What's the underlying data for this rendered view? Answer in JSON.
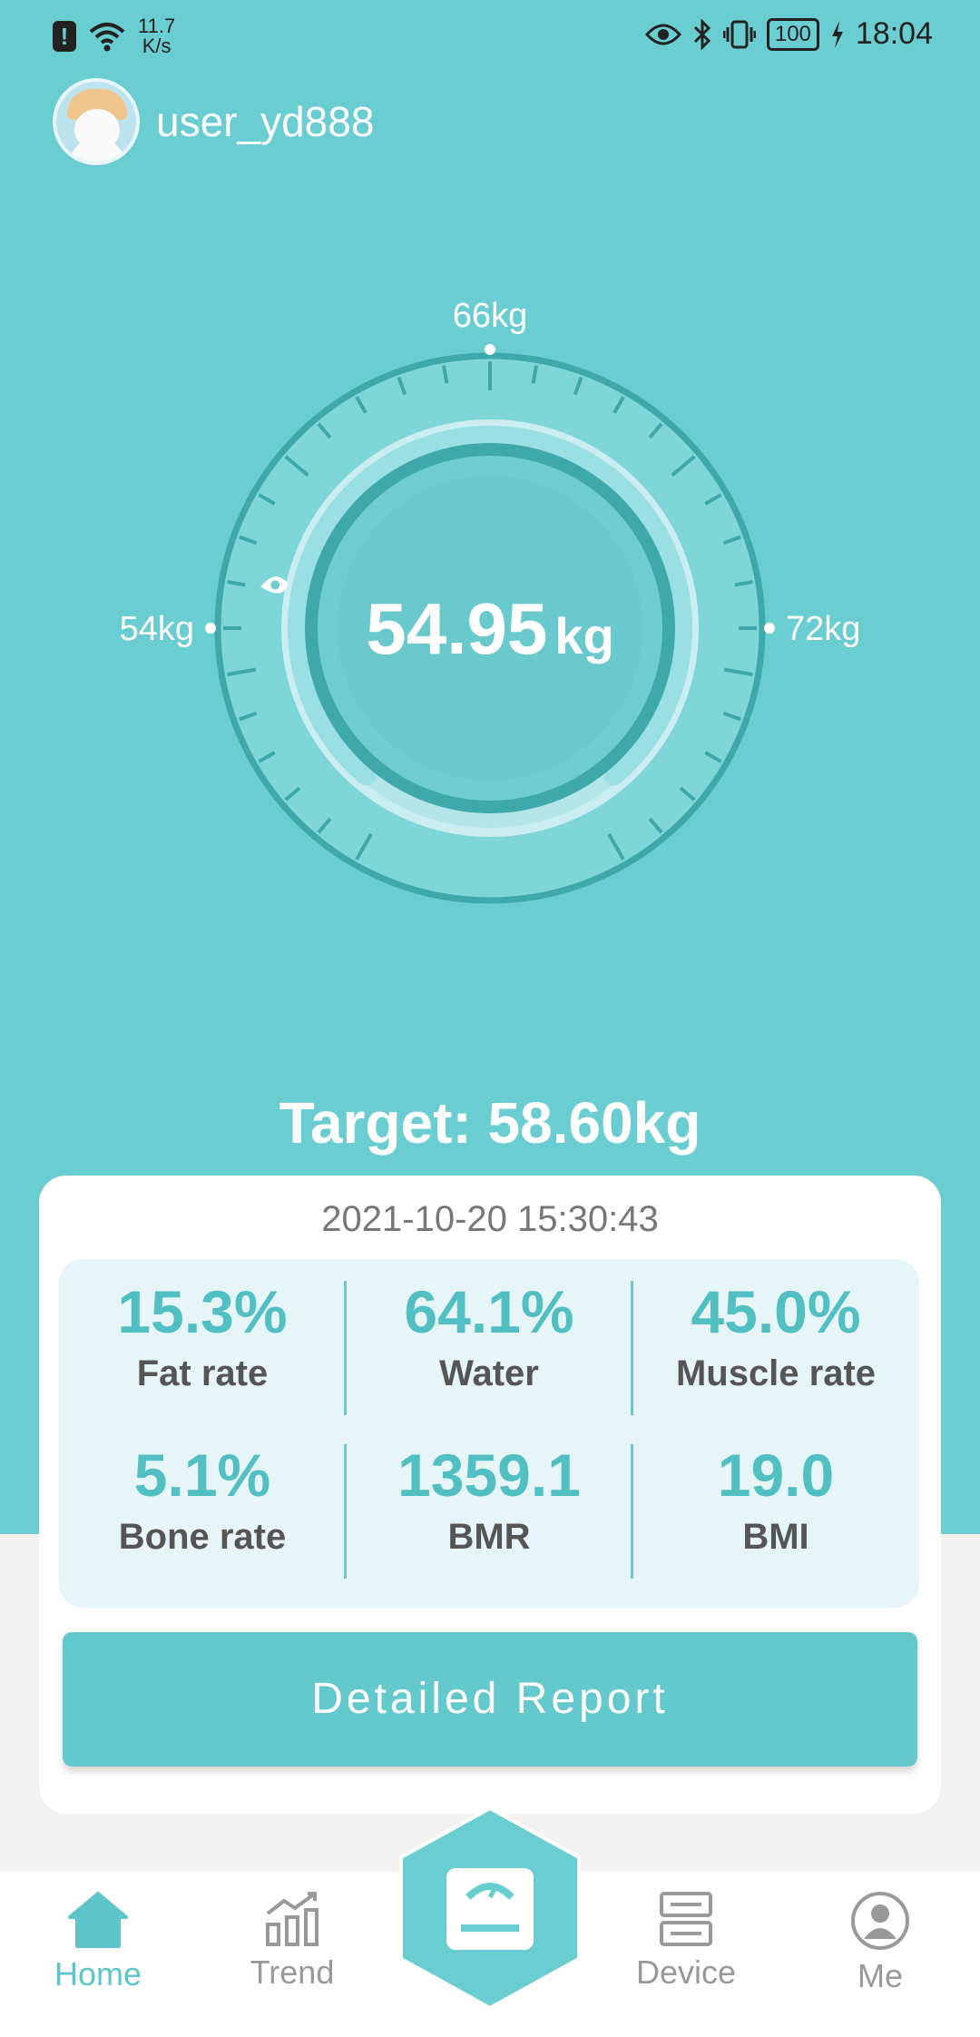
{
  "status_bar": {
    "net_speed_value": "11.7",
    "net_speed_unit": "K/s",
    "battery": "100",
    "time": "18:04"
  },
  "profile": {
    "username": "user_yd888"
  },
  "gauge": {
    "weight_value": "54.95",
    "weight_unit": "kg",
    "label_min": "54kg",
    "label_mid": "66kg",
    "label_max": "72kg",
    "min": 54,
    "max": 72,
    "current": 54.95
  },
  "target_text": "Target: 58.60kg",
  "record": {
    "datetime": "2021-10-20 15:30:43",
    "metrics": [
      {
        "value": "15.3%",
        "label": "Fat rate"
      },
      {
        "value": "64.1%",
        "label": "Water"
      },
      {
        "value": "45.0%",
        "label": "Muscle rate"
      },
      {
        "value": "5.1%",
        "label": "Bone rate"
      },
      {
        "value": "1359.1",
        "label": "BMR"
      },
      {
        "value": "19.0",
        "label": "BMI"
      }
    ]
  },
  "report_button": "Detailed Report",
  "tabs": [
    {
      "label": "Home"
    },
    {
      "label": "Trend"
    },
    {
      "label": "Device"
    },
    {
      "label": "Me"
    }
  ],
  "colors": {
    "accent": "#69cdd1",
    "metric_value": "#52bfc3",
    "tab_active": "#5ec6ca",
    "tab_inactive": "#999999"
  }
}
